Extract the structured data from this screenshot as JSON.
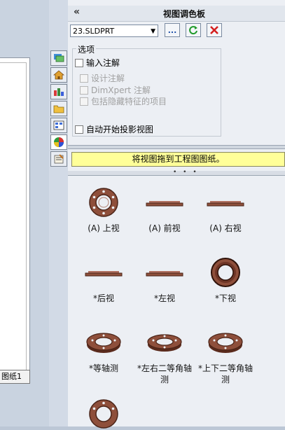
{
  "drawing": {
    "sheet_tab": "图纸1"
  },
  "panel": {
    "collapse": "«",
    "title": "视图调色板",
    "file": {
      "name": "23.SLDPRT",
      "browse_label": "..."
    },
    "options": {
      "legend": "选项",
      "import_annotations": "输入注解",
      "design_annotations": "设计注解",
      "dimxpert_annotations": "DimXpert 注解",
      "include_hidden": "包括隐藏特征的项目",
      "auto_projection": "自动开始投影视图"
    },
    "hint": "将视图拖到工程图图纸。",
    "grip": "• • •"
  },
  "views": [
    {
      "label": "(A) 上视",
      "icon": "ring-top-icon"
    },
    {
      "label": "(A) 前视",
      "icon": "flat-side-icon"
    },
    {
      "label": "(A) 右视",
      "icon": "flat-side-icon"
    },
    {
      "label": "*后视",
      "icon": "flat-side-icon"
    },
    {
      "label": "*左视",
      "icon": "flat-side-icon"
    },
    {
      "label": "*下视",
      "icon": "ring-bottom-icon"
    },
    {
      "label": "*等轴测",
      "icon": "iso-icon"
    },
    {
      "label": "*左右二等角轴测",
      "icon": "iso-icon"
    },
    {
      "label": "*上下二等角轴测",
      "icon": "iso-icon"
    }
  ],
  "colors": {
    "part": "#8e4f3b",
    "part_dark": "#4a2418",
    "hint_bg": "#ffff99"
  }
}
